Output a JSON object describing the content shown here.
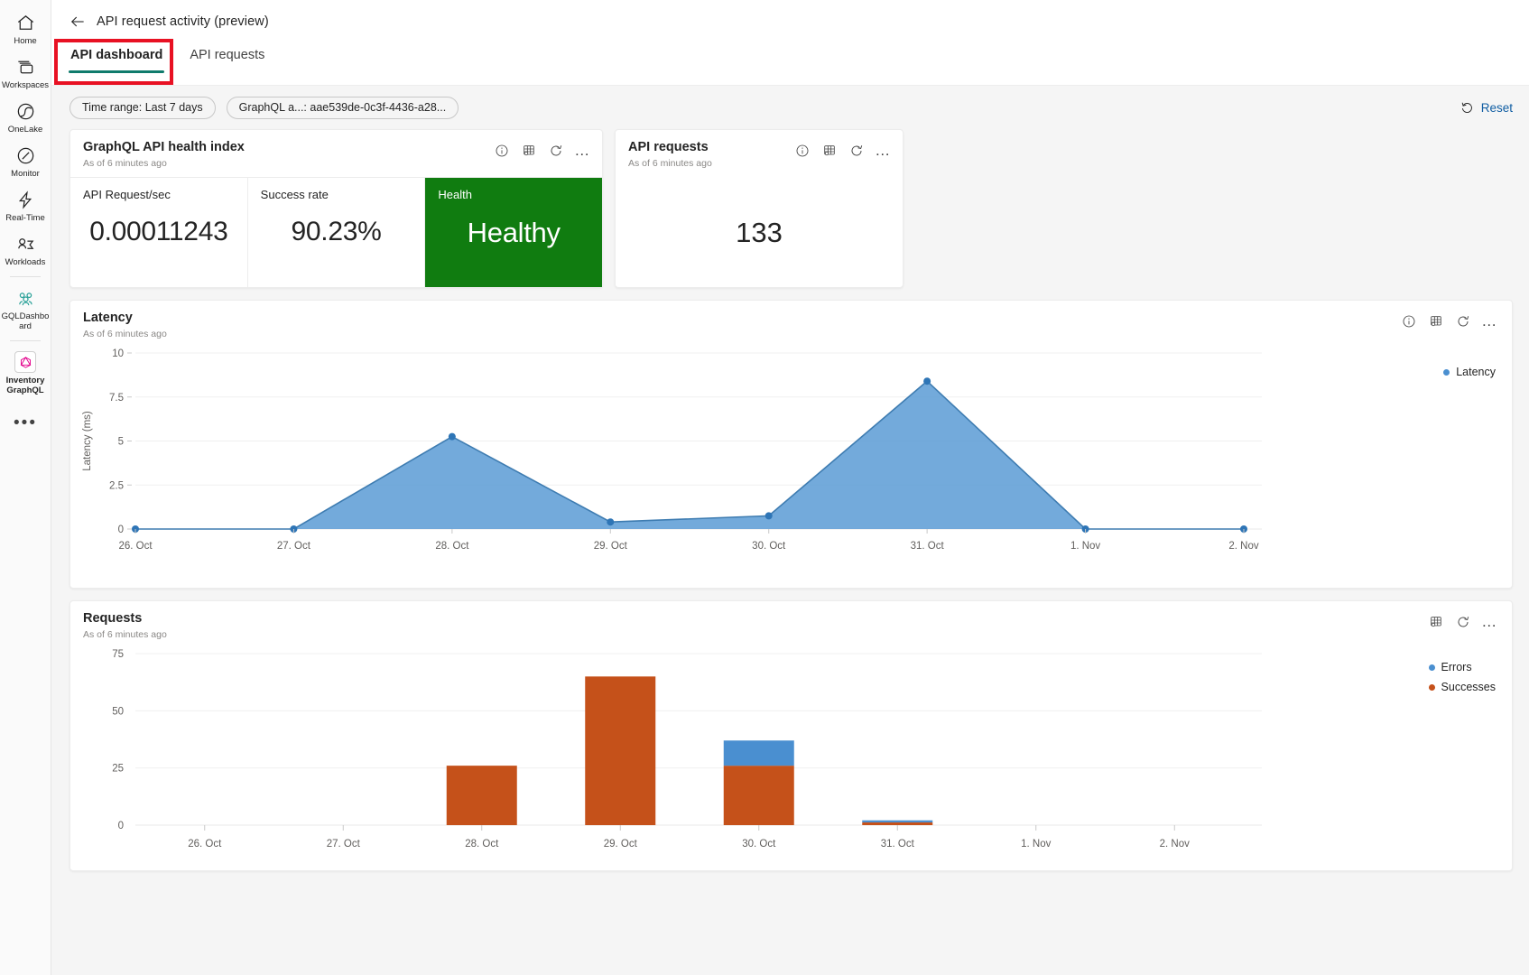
{
  "sidebar": {
    "items": [
      {
        "label": "Home",
        "icon": "home-icon"
      },
      {
        "label": "Workspaces",
        "icon": "workspaces-icon"
      },
      {
        "label": "OneLake",
        "icon": "onelake-icon"
      },
      {
        "label": "Monitor",
        "icon": "monitor-icon"
      },
      {
        "label": "Real-Time",
        "icon": "real-time-icon"
      },
      {
        "label": "Workloads",
        "icon": "workloads-icon"
      },
      {
        "label": "GQLDashboard",
        "icon": "gql-dashboard-icon"
      },
      {
        "label": "Inventory GraphQL",
        "icon": "inventory-graphql-icon"
      }
    ],
    "more": "•••"
  },
  "header": {
    "back": "←",
    "title": "API request activity (preview)"
  },
  "tabs": [
    {
      "label": "API dashboard",
      "active": true
    },
    {
      "label": "API requests",
      "active": false
    }
  ],
  "filters": {
    "time_range": "Time range: Last 7 days",
    "api": "GraphQL a...: aae539de-0c3f-4436-a28...",
    "reset_label": "Reset"
  },
  "health_card": {
    "title": "GraphQL API health index",
    "subtitle": "As of 6 minutes ago",
    "kpis": [
      {
        "label": "API Request/sec",
        "value": "0.00011243"
      },
      {
        "label": "Success rate",
        "value": "90.23%"
      },
      {
        "label": "Health",
        "value": "Healthy"
      }
    ],
    "health_color": "#107c10"
  },
  "requests_card": {
    "title": "API requests",
    "subtitle": "As of 6 minutes ago",
    "value": "133"
  },
  "latency_panel": {
    "title": "Latency",
    "subtitle": "As of 6 minutes ago"
  },
  "requests_panel": {
    "title": "Requests",
    "subtitle": "As of 6 minutes ago"
  },
  "chart_data": [
    {
      "type": "area",
      "title": "Latency",
      "xlabel": "",
      "ylabel": "Latency (ms)",
      "categories": [
        "26. Oct",
        "27. Oct",
        "28. Oct",
        "29. Oct",
        "30. Oct",
        "31. Oct",
        "1. Nov",
        "2. Nov"
      ],
      "ylim": [
        0,
        10
      ],
      "yticks": [
        0,
        2.5,
        5,
        7.5,
        10
      ],
      "ytick_labels": [
        "0",
        "2.5",
        "5",
        "7.5",
        "10"
      ],
      "grid": true,
      "legend": "right",
      "series": [
        {
          "name": "Latency",
          "color": "#5b9bd5",
          "values": [
            0,
            0,
            5.25,
            0.4,
            0.75,
            8.4,
            0,
            0
          ]
        }
      ]
    },
    {
      "type": "bar",
      "title": "Requests",
      "stacked": true,
      "xlabel": "",
      "ylabel": "",
      "categories": [
        "26. Oct",
        "27. Oct",
        "28. Oct",
        "29. Oct",
        "30. Oct",
        "31. Oct",
        "1. Nov",
        "2. Nov"
      ],
      "ylim": [
        0,
        75
      ],
      "yticks": [
        0,
        25,
        50,
        75
      ],
      "ytick_labels": [
        "0",
        "25",
        "50",
        "75"
      ],
      "grid": true,
      "legend": "right",
      "series": [
        {
          "name": "Successes",
          "color": "#c5511a",
          "values": [
            0,
            0,
            26,
            65,
            26,
            1.2,
            0,
            0
          ]
        },
        {
          "name": "Errors",
          "color": "#4a8fd0",
          "values": [
            0,
            0,
            0,
            0,
            11,
            0.9,
            0,
            0
          ]
        }
      ]
    }
  ]
}
